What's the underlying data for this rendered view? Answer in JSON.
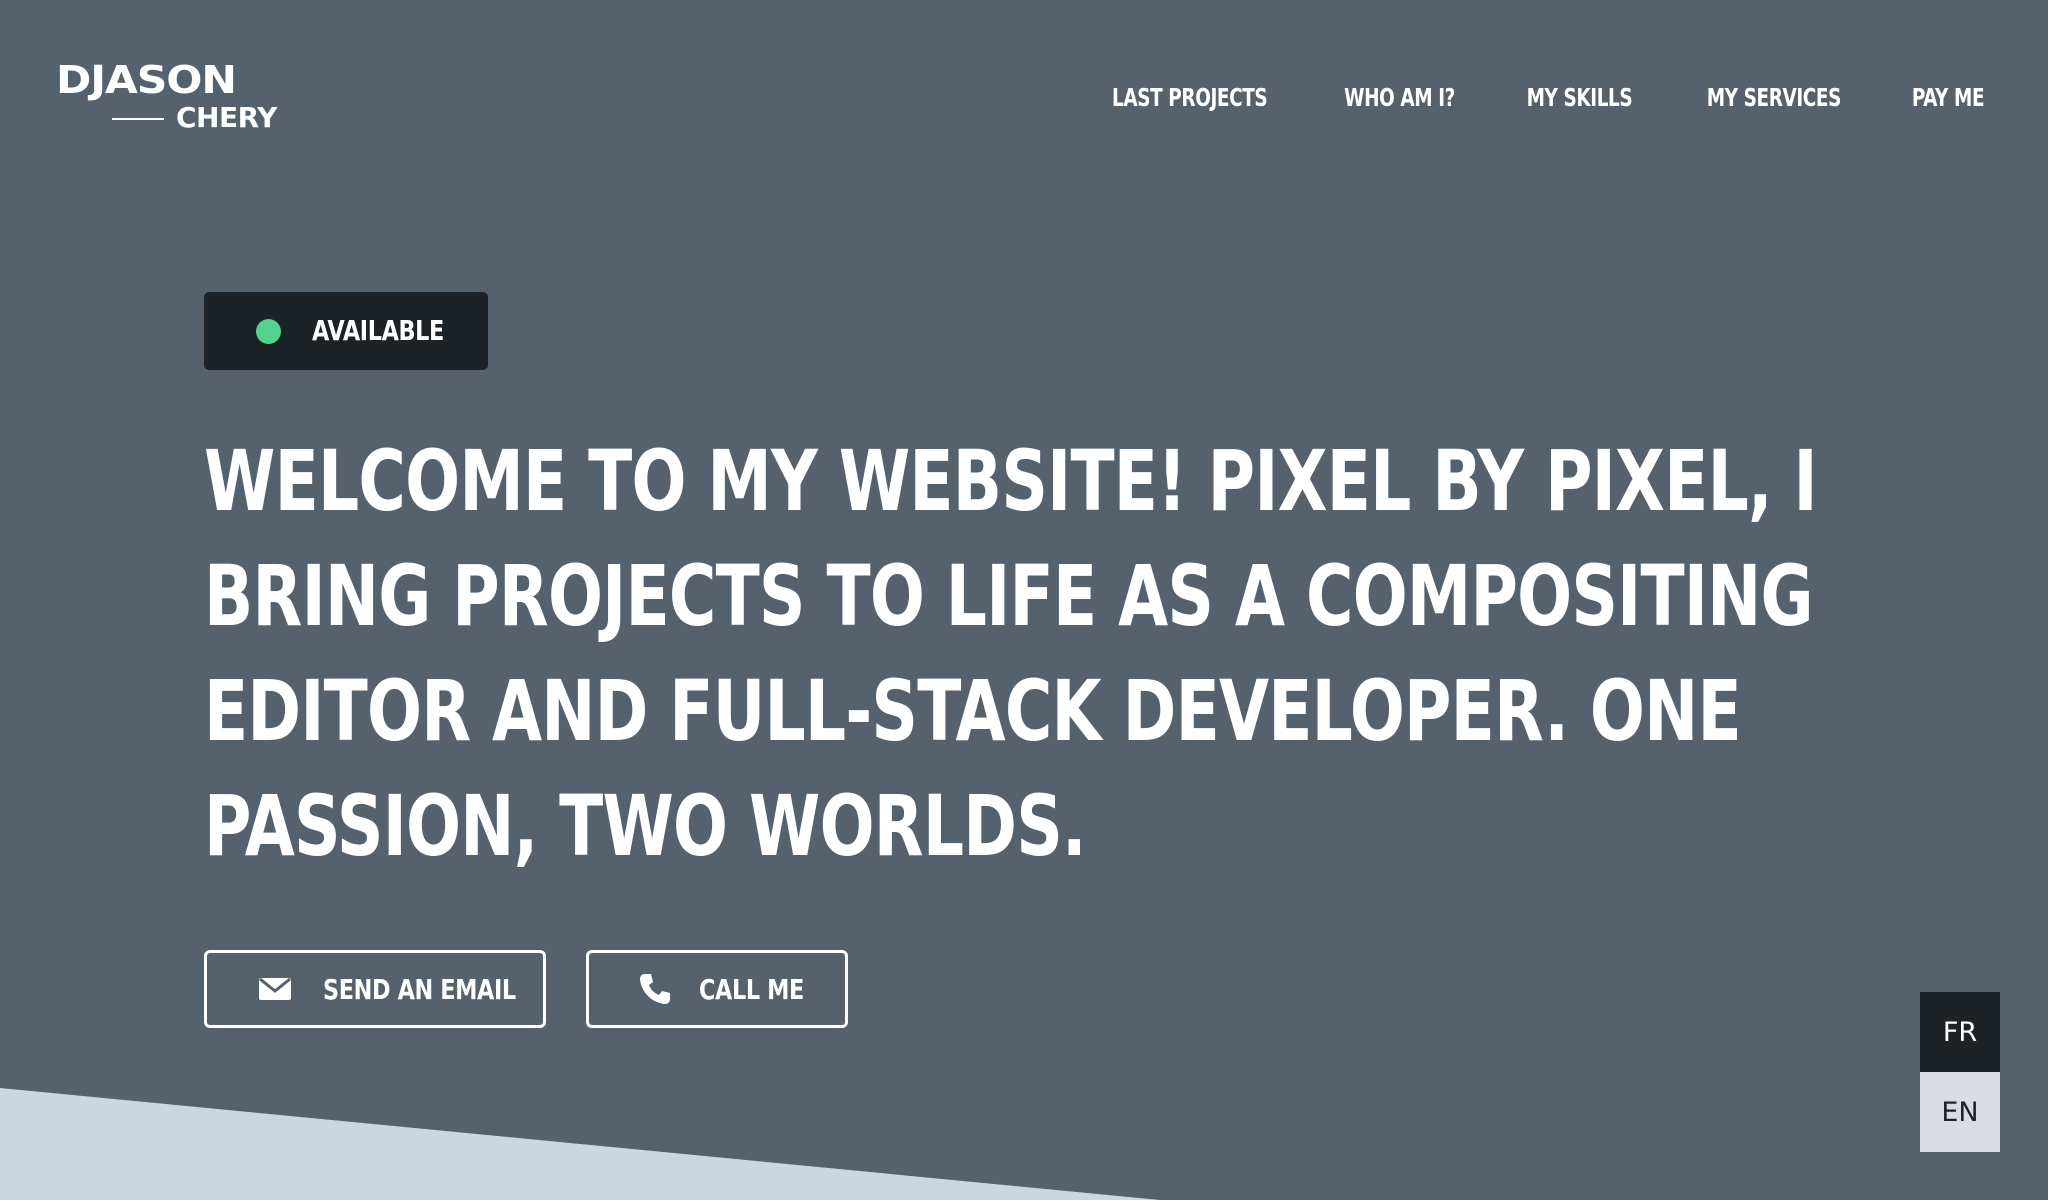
{
  "logo": {
    "main": "DJASON",
    "sub": "CHERY"
  },
  "nav": {
    "items": [
      {
        "label": "LAST PROJECTS"
      },
      {
        "label": "WHO AM I?"
      },
      {
        "label": "MY SKILLS"
      },
      {
        "label": "MY SERVICES"
      },
      {
        "label": "PAY ME"
      }
    ]
  },
  "status": {
    "label": "AVAILABLE",
    "color": "#54d38a"
  },
  "hero": {
    "lines": [
      "WELCOME TO MY WEBSITE! PIXEL BY PIXEL, I",
      "BRING PROJECTS TO LIFE AS A COMPOSITING",
      "EDITOR AND FULL-STACK DEVELOPER. ONE",
      "PASSION, TWO WORLDS."
    ]
  },
  "actions": {
    "email": {
      "label": "SEND AN EMAIL",
      "icon": "envelope-icon"
    },
    "call": {
      "label": "CALL ME",
      "icon": "phone-icon"
    }
  },
  "language": {
    "options": [
      "FR",
      "EN"
    ],
    "active": "FR"
  },
  "colors": {
    "background": "#55626e",
    "dark": "#1d2227",
    "wedge": "#cdd6df",
    "accent": "#54d38a"
  }
}
